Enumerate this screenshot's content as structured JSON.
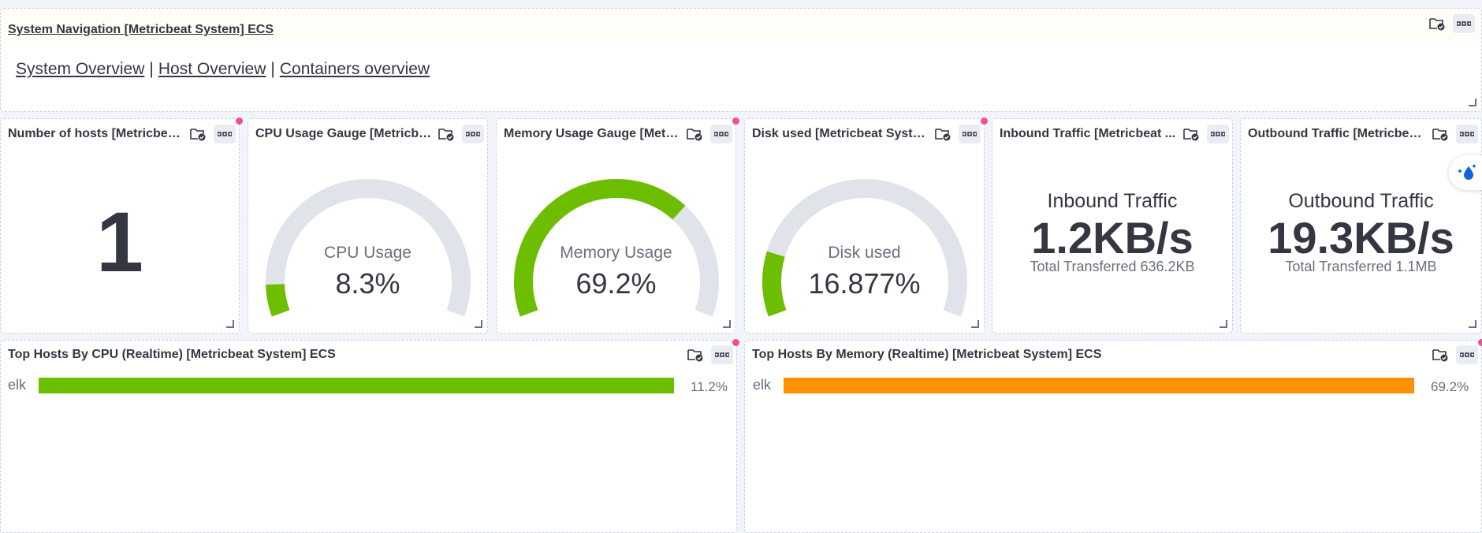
{
  "nav_panel": {
    "title": "System Navigation [Metricbeat System] ECS",
    "links": [
      "System Overview",
      "Host Overview",
      "Containers overview"
    ],
    "separator": "|"
  },
  "panels": {
    "hosts": {
      "title": "Number of hosts [Metricbeat...",
      "value": "1"
    },
    "cpu": {
      "title": "CPU Usage Gauge [Metricbe...",
      "label": "CPU Usage",
      "value": "8.3%",
      "fraction": 0.083,
      "color": "#6dbe00"
    },
    "memory": {
      "title": "Memory Usage Gauge [Metri...",
      "label": "Memory Usage",
      "value": "69.2%",
      "fraction": 0.692,
      "color": "#6dbe00"
    },
    "disk": {
      "title": "Disk used [Metricbeat Syste...",
      "label": "Disk used",
      "value": "16.877%",
      "fraction": 0.16877,
      "color": "#6dbe00"
    },
    "inbound": {
      "title": "Inbound Traffic [Metricbeat ...",
      "label": "Inbound Traffic",
      "value": "1.2KB/s",
      "sub": "Total Transferred 636.2KB"
    },
    "outbound": {
      "title": "Outbound Traffic [Metricbea...",
      "label": "Outbound Traffic",
      "value": "19.3KB/s",
      "sub": "Total Transferred 1.1MB"
    },
    "top_cpu": {
      "title": "Top Hosts By CPU (Realtime) [Metricbeat System] ECS",
      "host": "elk",
      "value": "11.2%",
      "color": "#6dbe00"
    },
    "top_mem": {
      "title": "Top Hosts By Memory (Realtime) [Metricbeat System] ECS",
      "host": "elk",
      "value": "69.2%",
      "color": "#ff9100"
    }
  },
  "icons": {
    "save": "folder-check-icon",
    "more": "more-options-icon",
    "resize": "resize-handle-icon",
    "assistant": "ai-assistant-icon"
  },
  "colors": {
    "gauge_track": "#e0e3ea",
    "accent_pink": "#f04e98"
  }
}
